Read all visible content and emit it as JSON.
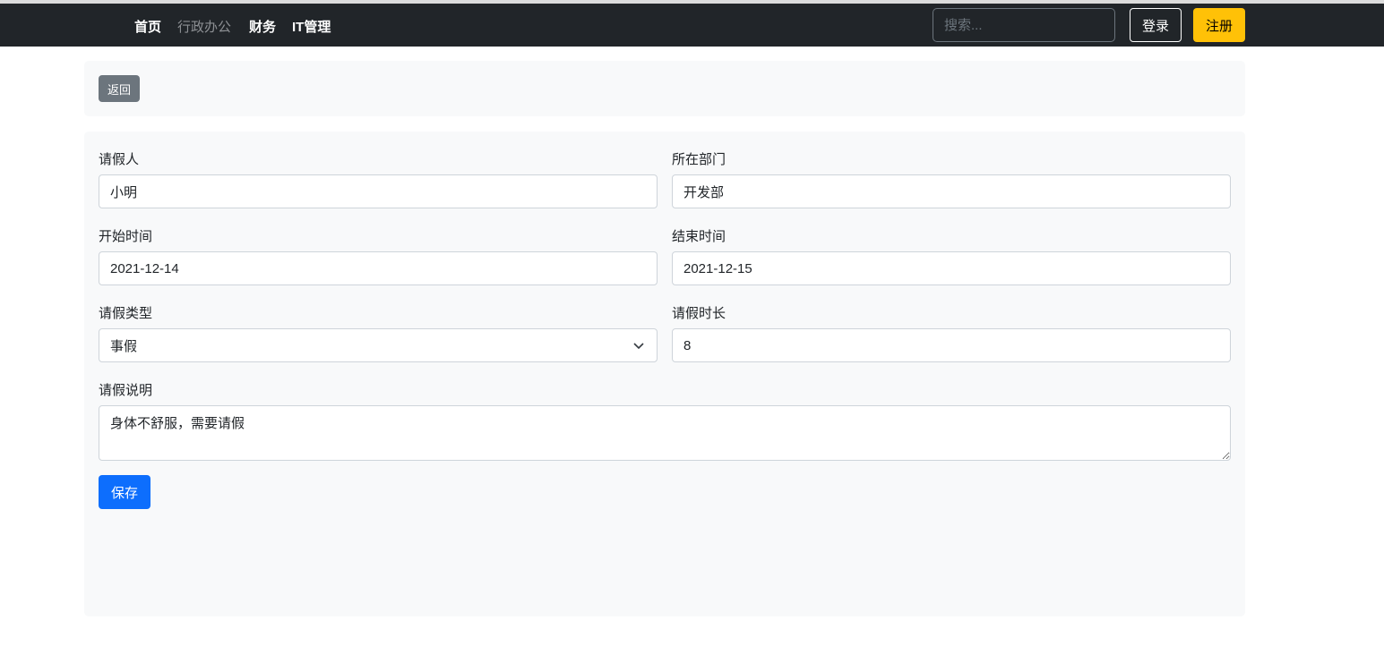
{
  "nav": {
    "items": [
      "首页",
      "行政办公",
      "财务",
      "IT管理"
    ],
    "search_placeholder": "搜索...",
    "login": "登录",
    "register": "注册"
  },
  "toolbar": {
    "back": "返回"
  },
  "form": {
    "applicant_label": "请假人",
    "applicant": "小明",
    "dept_label": "所在部门",
    "dept": "开发部",
    "start_label": "开始时间",
    "start": "2021-12-14",
    "end_label": "结束时间",
    "end": "2021-12-15",
    "type_label": "请假类型",
    "type": "事假",
    "duration_label": "请假时长",
    "duration": "8",
    "desc_label": "请假说明",
    "desc": "身体不舒服，需要请假",
    "save": "保存"
  }
}
